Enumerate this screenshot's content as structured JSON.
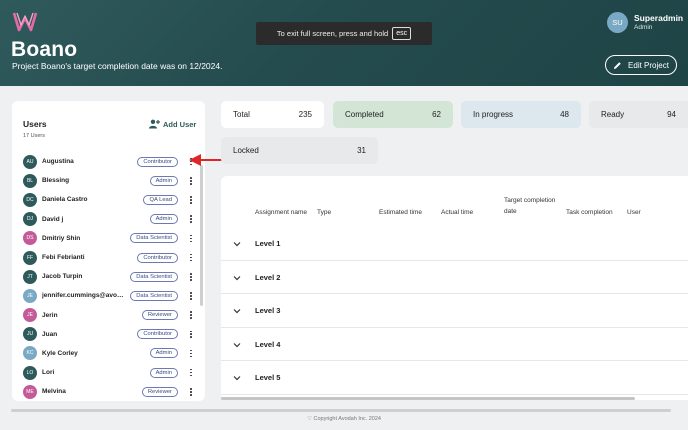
{
  "header": {
    "project_title": "Boano",
    "project_subtitle": "Project Boano's target completion date was on 12/2024.",
    "fullscreen_text": "To exit full screen, press and hold",
    "fullscreen_key": "esc",
    "user": {
      "initials": "SU",
      "name": "Superadmin",
      "role": "Admin"
    },
    "edit_label": "Edit Project"
  },
  "users": {
    "title": "Users",
    "count": "17 Users",
    "add_label": "Add User",
    "items": [
      {
        "initials": "AU",
        "name": "Augustina",
        "role": "Contributor",
        "color": "#2f5a5c"
      },
      {
        "initials": "BL",
        "name": "Blessing",
        "role": "Admin",
        "color": "#2f5a5c"
      },
      {
        "initials": "DC",
        "name": "Daniela Castro",
        "role": "QA Lead",
        "color": "#2f5a5c"
      },
      {
        "initials": "DJ",
        "name": "David j",
        "role": "Admin",
        "color": "#2f5a5c"
      },
      {
        "initials": "DS",
        "name": "Dmitriy Shin",
        "role": "Data Scientist",
        "color": "#c45a9a"
      },
      {
        "initials": "FF",
        "name": "Febi Febrianti",
        "role": "Contributor",
        "color": "#2f5a5c"
      },
      {
        "initials": "JT",
        "name": "Jacob Turpin",
        "role": "Data Scientist",
        "color": "#2f5a5c"
      },
      {
        "initials": "JE",
        "name": "jennifer.cummings@avod...",
        "role": "Data Scientist",
        "color": "#7aa9c5"
      },
      {
        "initials": "JE",
        "name": "Jerin",
        "role": "Reviewer",
        "color": "#c45a9a"
      },
      {
        "initials": "JU",
        "name": "Juan",
        "role": "Contributor",
        "color": "#2f5a5c"
      },
      {
        "initials": "KC",
        "name": "Kyle Corley",
        "role": "Admin",
        "color": "#7aa9c5"
      },
      {
        "initials": "LO",
        "name": "Lori",
        "role": "Admin",
        "color": "#2f5a5c"
      },
      {
        "initials": "ME",
        "name": "Melvina",
        "role": "Reviewer",
        "color": "#c45a9a"
      }
    ]
  },
  "stats": {
    "total": {
      "label": "Total",
      "value": "235",
      "color": "#ffffff"
    },
    "completed": {
      "label": "Completed",
      "value": "62",
      "color": "#d3e6d6"
    },
    "in_progress": {
      "label": "In progress",
      "value": "48",
      "color": "#dce8ee"
    },
    "ready": {
      "label": "Ready",
      "value": "94",
      "color": "#e8e9ea"
    },
    "locked": {
      "label": "Locked",
      "value": "31",
      "color": "#e8e9ea"
    }
  },
  "table": {
    "columns": {
      "assignment": "Assignment name",
      "type": "Type",
      "estimated": "Estimated time",
      "actual": "Actual time",
      "target_line1": "Target completion",
      "target_line2": "date",
      "task_completion": "Task completion",
      "user": "User"
    },
    "levels": [
      "Level 1",
      "Level 2",
      "Level 3",
      "Level 4",
      "Level 5"
    ]
  },
  "footer": {
    "copyright": "Copyright Avodah Inc. 2024"
  }
}
